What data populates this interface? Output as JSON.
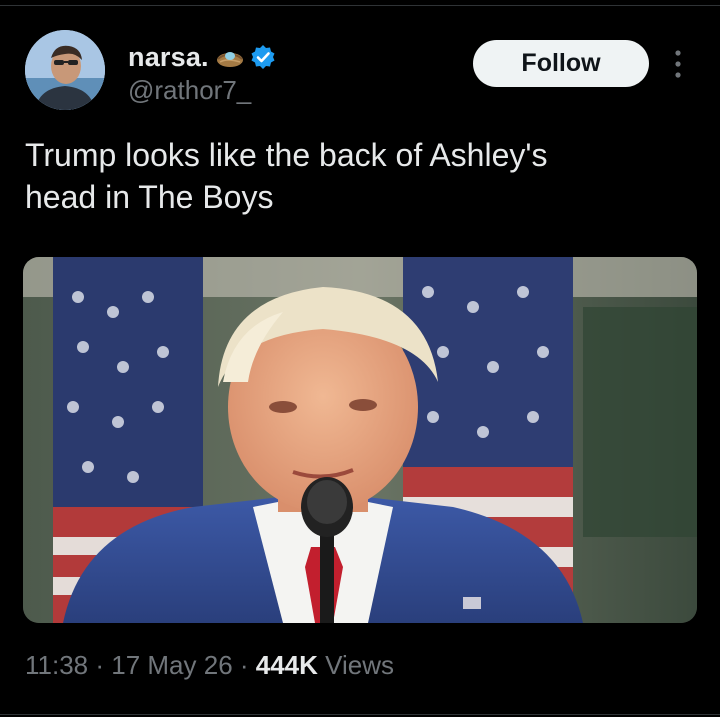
{
  "tweet": {
    "author": {
      "display_name": "narsa.",
      "handle": "@rathor7_",
      "name_emoji_icon": "nest-egg-emoji-icon",
      "verified_icon": "verified-badge-icon",
      "verified_color": "#1d9bf0"
    },
    "follow_label": "Follow",
    "more_icon": "more-vertical-icon",
    "text": "Trump looks like the back of Ashley's\nhead in The Boys",
    "media": {
      "kind": "photo"
    },
    "meta": {
      "time": "11:38",
      "separator": " · ",
      "date": "17 May 26",
      "views_count": "444K",
      "views_label": "Views"
    }
  },
  "colors": {
    "background": "#000000",
    "primary_text": "#e7e9ea",
    "secondary_text": "#71767b",
    "follow_button_bg": "#eff3f4",
    "divider": "#2f3336"
  }
}
